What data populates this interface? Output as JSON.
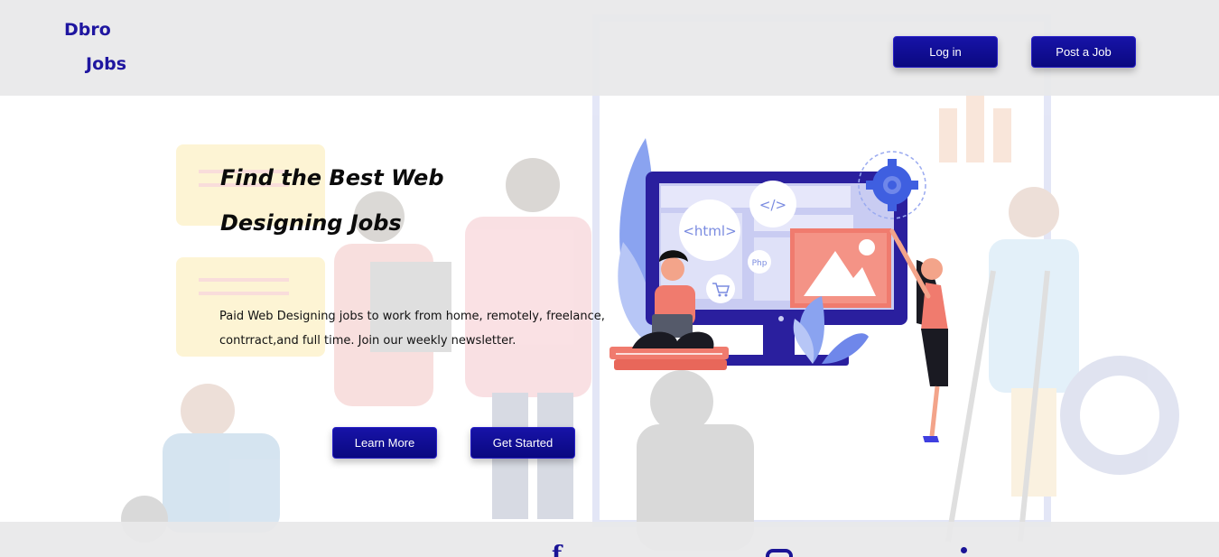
{
  "header": {
    "logo_line1": "Dbro",
    "logo_line2": "Jobs",
    "login_label": "Log in",
    "post_job_label": "Post a Job"
  },
  "hero": {
    "title_line1": "Find the Best Web",
    "title_line2": "Designing Jobs",
    "description_line1": "Paid Web Designing jobs to work from home, remotely, freelance,",
    "description_line2": "contrract,and full time. Join our weekly newsletter.",
    "learn_more_label": "Learn More",
    "get_started_label": "Get Started",
    "illustration": {
      "html_tag": "<html>",
      "code_tag": "</>",
      "php_tag": "Php"
    }
  },
  "footer": {
    "social_icons": [
      "facebook-icon",
      "instagram-icon",
      "linkedin-icon"
    ]
  },
  "colors": {
    "brand": "#1f16a0",
    "button": "#0e0c96",
    "header_bg": "#e8e8ea"
  }
}
